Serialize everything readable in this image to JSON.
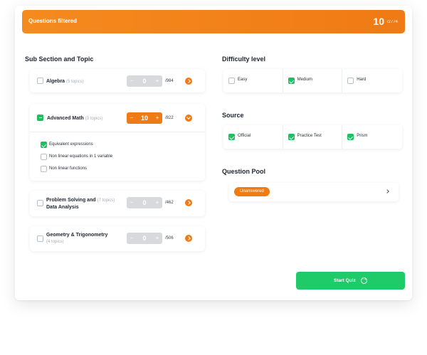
{
  "header": {
    "title": "Questions filtered",
    "count": "10",
    "total": "/2774"
  },
  "left": {
    "title": "Sub Section and Topic",
    "topics": [
      {
        "name": "Algebra",
        "sub": "(5 topics)",
        "value": "0",
        "max": "/984",
        "checked": false,
        "expanded": false
      },
      {
        "name": "Advanced Math",
        "sub": "(3 topics)",
        "value": "10",
        "max": "/822",
        "checked": "partial",
        "expanded": true,
        "subtopics": [
          {
            "label": "Equivalent expressions",
            "checked": true
          },
          {
            "label": "Non linear equations in 1 variable",
            "checked": false
          },
          {
            "label": "Non linear functions",
            "checked": false
          }
        ]
      },
      {
        "name_line1": "Problem Solving and",
        "name_line2": "Data Analysis",
        "sub": "(7 topics)",
        "value": "0",
        "max": "/462",
        "checked": false,
        "expanded": false
      },
      {
        "name": "Geometry & Trigonometry",
        "sub": "(4 topics)",
        "value": "0",
        "max": "/506",
        "checked": false,
        "expanded": false
      }
    ],
    "stepper_minus": "−",
    "stepper_plus": "+"
  },
  "difficulty": {
    "title": "Difficulty level",
    "options": [
      {
        "label": "Easy",
        "checked": false
      },
      {
        "label": "Medium",
        "checked": true
      },
      {
        "label": "Hard",
        "checked": false
      }
    ]
  },
  "source": {
    "title": "Source",
    "options": [
      {
        "label": "Official",
        "checked": true
      },
      {
        "label": "Practice Test",
        "checked": true
      },
      {
        "label": "Prism",
        "checked": true
      }
    ]
  },
  "pool": {
    "title": "Question Pool",
    "selected": "Unanswered"
  },
  "start_button": {
    "label": "Start Quiz"
  },
  "colors": {
    "accent": "#f07a14",
    "success": "#1fca68",
    "check": "#1fbf5f",
    "stepper_disabled": "#d7d9dd"
  },
  "icons": {
    "expand": "chevron-right-icon",
    "collapse": "chevron-down-icon",
    "start": "arrow-right-circle-icon",
    "pool": "chevron-right-icon"
  }
}
